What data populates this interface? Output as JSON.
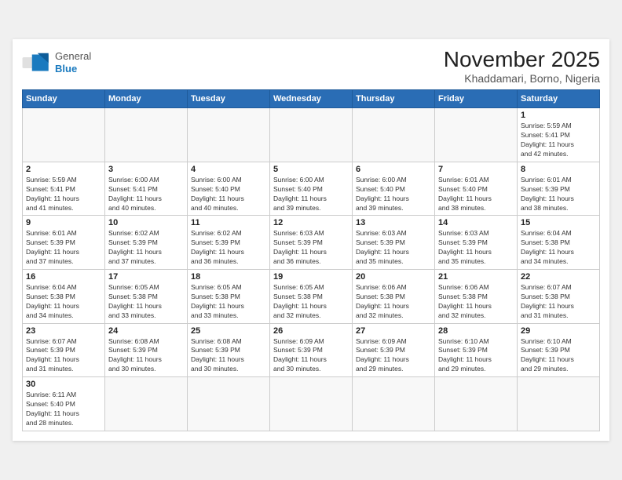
{
  "header": {
    "logo_general": "General",
    "logo_blue": "Blue",
    "month": "November 2025",
    "location": "Khaddamari, Borno, Nigeria"
  },
  "weekdays": [
    "Sunday",
    "Monday",
    "Tuesday",
    "Wednesday",
    "Thursday",
    "Friday",
    "Saturday"
  ],
  "weeks": [
    [
      {
        "day": "",
        "info": ""
      },
      {
        "day": "",
        "info": ""
      },
      {
        "day": "",
        "info": ""
      },
      {
        "day": "",
        "info": ""
      },
      {
        "day": "",
        "info": ""
      },
      {
        "day": "",
        "info": ""
      },
      {
        "day": "1",
        "info": "Sunrise: 5:59 AM\nSunset: 5:41 PM\nDaylight: 11 hours\nand 42 minutes."
      }
    ],
    [
      {
        "day": "2",
        "info": "Sunrise: 5:59 AM\nSunset: 5:41 PM\nDaylight: 11 hours\nand 41 minutes."
      },
      {
        "day": "3",
        "info": "Sunrise: 6:00 AM\nSunset: 5:41 PM\nDaylight: 11 hours\nand 40 minutes."
      },
      {
        "day": "4",
        "info": "Sunrise: 6:00 AM\nSunset: 5:40 PM\nDaylight: 11 hours\nand 40 minutes."
      },
      {
        "day": "5",
        "info": "Sunrise: 6:00 AM\nSunset: 5:40 PM\nDaylight: 11 hours\nand 39 minutes."
      },
      {
        "day": "6",
        "info": "Sunrise: 6:00 AM\nSunset: 5:40 PM\nDaylight: 11 hours\nand 39 minutes."
      },
      {
        "day": "7",
        "info": "Sunrise: 6:01 AM\nSunset: 5:40 PM\nDaylight: 11 hours\nand 38 minutes."
      },
      {
        "day": "8",
        "info": "Sunrise: 6:01 AM\nSunset: 5:39 PM\nDaylight: 11 hours\nand 38 minutes."
      }
    ],
    [
      {
        "day": "9",
        "info": "Sunrise: 6:01 AM\nSunset: 5:39 PM\nDaylight: 11 hours\nand 37 minutes."
      },
      {
        "day": "10",
        "info": "Sunrise: 6:02 AM\nSunset: 5:39 PM\nDaylight: 11 hours\nand 37 minutes."
      },
      {
        "day": "11",
        "info": "Sunrise: 6:02 AM\nSunset: 5:39 PM\nDaylight: 11 hours\nand 36 minutes."
      },
      {
        "day": "12",
        "info": "Sunrise: 6:03 AM\nSunset: 5:39 PM\nDaylight: 11 hours\nand 36 minutes."
      },
      {
        "day": "13",
        "info": "Sunrise: 6:03 AM\nSunset: 5:39 PM\nDaylight: 11 hours\nand 35 minutes."
      },
      {
        "day": "14",
        "info": "Sunrise: 6:03 AM\nSunset: 5:39 PM\nDaylight: 11 hours\nand 35 minutes."
      },
      {
        "day": "15",
        "info": "Sunrise: 6:04 AM\nSunset: 5:38 PM\nDaylight: 11 hours\nand 34 minutes."
      }
    ],
    [
      {
        "day": "16",
        "info": "Sunrise: 6:04 AM\nSunset: 5:38 PM\nDaylight: 11 hours\nand 34 minutes."
      },
      {
        "day": "17",
        "info": "Sunrise: 6:05 AM\nSunset: 5:38 PM\nDaylight: 11 hours\nand 33 minutes."
      },
      {
        "day": "18",
        "info": "Sunrise: 6:05 AM\nSunset: 5:38 PM\nDaylight: 11 hours\nand 33 minutes."
      },
      {
        "day": "19",
        "info": "Sunrise: 6:05 AM\nSunset: 5:38 PM\nDaylight: 11 hours\nand 32 minutes."
      },
      {
        "day": "20",
        "info": "Sunrise: 6:06 AM\nSunset: 5:38 PM\nDaylight: 11 hours\nand 32 minutes."
      },
      {
        "day": "21",
        "info": "Sunrise: 6:06 AM\nSunset: 5:38 PM\nDaylight: 11 hours\nand 32 minutes."
      },
      {
        "day": "22",
        "info": "Sunrise: 6:07 AM\nSunset: 5:38 PM\nDaylight: 11 hours\nand 31 minutes."
      }
    ],
    [
      {
        "day": "23",
        "info": "Sunrise: 6:07 AM\nSunset: 5:39 PM\nDaylight: 11 hours\nand 31 minutes."
      },
      {
        "day": "24",
        "info": "Sunrise: 6:08 AM\nSunset: 5:39 PM\nDaylight: 11 hours\nand 30 minutes."
      },
      {
        "day": "25",
        "info": "Sunrise: 6:08 AM\nSunset: 5:39 PM\nDaylight: 11 hours\nand 30 minutes."
      },
      {
        "day": "26",
        "info": "Sunrise: 6:09 AM\nSunset: 5:39 PM\nDaylight: 11 hours\nand 30 minutes."
      },
      {
        "day": "27",
        "info": "Sunrise: 6:09 AM\nSunset: 5:39 PM\nDaylight: 11 hours\nand 29 minutes."
      },
      {
        "day": "28",
        "info": "Sunrise: 6:10 AM\nSunset: 5:39 PM\nDaylight: 11 hours\nand 29 minutes."
      },
      {
        "day": "29",
        "info": "Sunrise: 6:10 AM\nSunset: 5:39 PM\nDaylight: 11 hours\nand 29 minutes."
      }
    ],
    [
      {
        "day": "30",
        "info": "Sunrise: 6:11 AM\nSunset: 5:40 PM\nDaylight: 11 hours\nand 28 minutes."
      },
      {
        "day": "",
        "info": ""
      },
      {
        "day": "",
        "info": ""
      },
      {
        "day": "",
        "info": ""
      },
      {
        "day": "",
        "info": ""
      },
      {
        "day": "",
        "info": ""
      },
      {
        "day": "",
        "info": ""
      }
    ]
  ]
}
